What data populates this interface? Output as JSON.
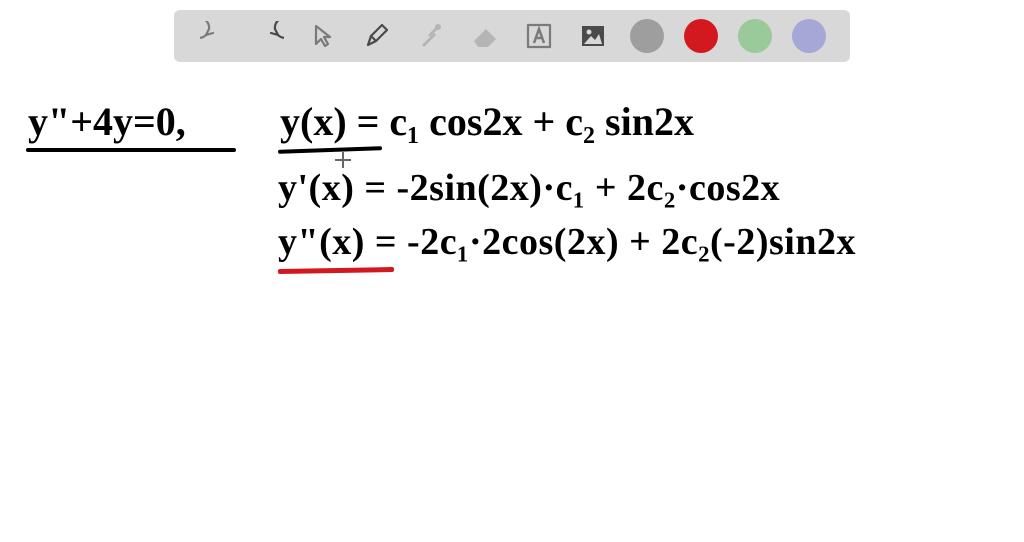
{
  "toolbar": {
    "colors": {
      "gray": "#9e9e9e",
      "red": "#d4181f",
      "green": "#9ac99a",
      "blue": "#a5a8d6"
    },
    "icons": {
      "undo": "undo-icon",
      "redo": "redo-icon",
      "pointer": "pointer-icon",
      "pen": "pen-icon",
      "tools": "tools-icon",
      "eraser": "eraser-icon",
      "text": "text-icon",
      "image": "image-icon"
    }
  },
  "canvas": {
    "line1_left": "y\"+4y=0,",
    "line1_right": "y(x) = c₁ cos2x + c₂ sin2x",
    "line2": "y'(x) = -2sin(2x)·c₁ + 2c₂·cos2x",
    "line3": "y\"(x) = -2c₁·2cos(2x) + 2c₂(-2)sin2x"
  }
}
